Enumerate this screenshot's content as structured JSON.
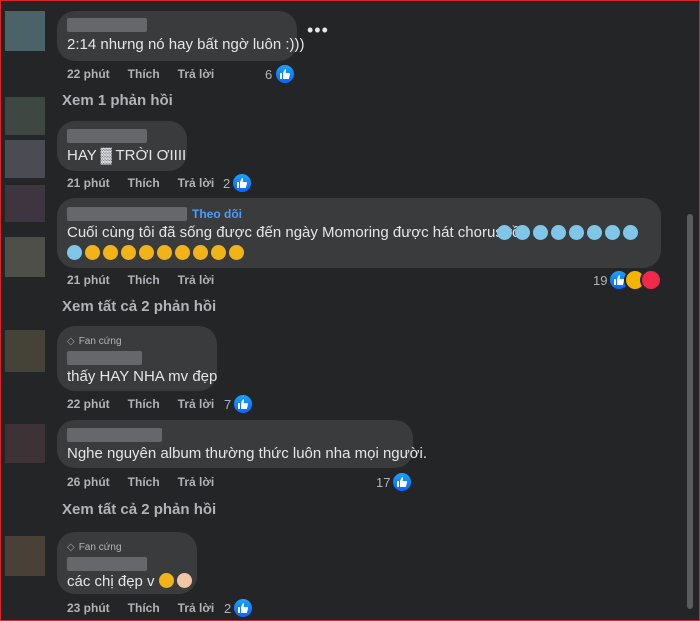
{
  "comments": [
    {
      "text": "2:14 nhưng nó hay bất ngờ luôn :)))",
      "time": "22 phút",
      "like": "Thích",
      "reply": "Trả lời",
      "count": "6"
    },
    {
      "text": "HAY ▓ TRỜI ƠIIII",
      "time": "21 phút",
      "like": "Thích",
      "reply": "Trả lời",
      "count": "2"
    },
    {
      "follow": "Theo dõi",
      "text": "Cuối cùng tôi đã sống được đến ngày Momoring được hát chorus rồi",
      "time": "21 phút",
      "like": "Thích",
      "reply": "Trả lời",
      "count": "19"
    },
    {
      "badge": "Fan cứng",
      "text": "thấy HAY NHA mv đẹp",
      "time": "22 phút",
      "like": "Thích",
      "reply": "Trả lời",
      "count": "7"
    },
    {
      "text": "Nghe nguyên album thường thức luôn nha mọi người.",
      "time": "26 phút",
      "like": "Thích",
      "reply": "Trả lời",
      "count": "17"
    },
    {
      "badge": "Fan cứng",
      "text": "các chị đẹp v",
      "time": "23 phút",
      "like": "Thích",
      "reply": "Trả lời",
      "count": "2"
    }
  ],
  "links": {
    "view_one": "Xem 1 phản hồi",
    "view_two_a": "Xem tất cả 2 phản hồi",
    "view_two_b": "Xem tất cả 2 phản hồi"
  },
  "colors": {
    "bg": "#242526",
    "bubble": "#3a3b3c",
    "text": "#e4e6eb",
    "muted": "#b0b3b8",
    "blue": "#0866ff"
  }
}
